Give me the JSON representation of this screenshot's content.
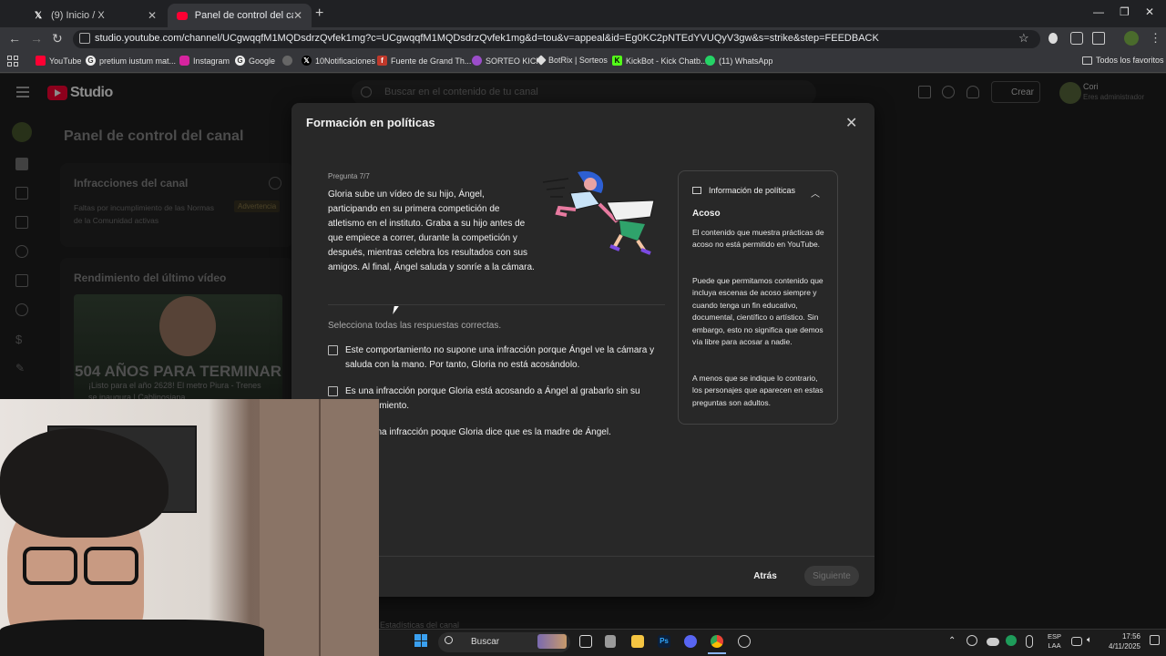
{
  "browser": {
    "tabs": [
      {
        "label": "(9) Inicio / X",
        "favicon": "X"
      },
      {
        "label": "Panel de control del canal - Yo",
        "favicon": "YT"
      }
    ],
    "url": "studio.youtube.com/channel/UCgwqqfM1MQDsdrzQvfek1mg?c=UCgwqqfM1MQDsdrzQvfek1mg&d=tou&v=appeal&id=Eg0KC2pNTEdYVUQyV3gw&s=strike&step=FEEDBACK",
    "bookmarks": [
      "YouTube",
      "pretium iustum mat...",
      "Instagram",
      "Google",
      "10Notificaciones",
      "Fuente de Grand Th...",
      "SORTEO KICK",
      "BotRix | Sorteos",
      "KickBot - Kick Chatb...",
      "(11) WhatsApp"
    ],
    "all_bookmarks": "Todos los favoritos"
  },
  "studio": {
    "logo": "Studio",
    "search_placeholder": "Buscar en el contenido de tu canal",
    "create": "Crear",
    "account_name": "Cori",
    "account_role": "Eres administrador",
    "dashboard_title": "Panel de control del canal",
    "infractions_title": "Infracciones del canal",
    "infractions_desc": "Faltas por incumplimiento de las Normas de la Comunidad activas",
    "infractions_badge": "Advertencia",
    "last_video_title": "Rendimiento del último vídeo",
    "thumb_text": "504 AÑOS PARA TERMINAR",
    "video_title": "¡Listo para el año 2628! El metro Piura - Trenes se inaugura | Cablinosiana",
    "analytics": "Estadísticas del canal"
  },
  "modal": {
    "title": "Formación en políticas",
    "counter": "Pregunta 7/7",
    "question": "Gloria sube un vídeo de su hijo, Ángel, participando en su primera competición de atletismo en el instituto. Graba a su hijo antes de que empiece a correr, durante la competición y después, mientras celebra los resultados con sus amigos. Al final, Ángel saluda y sonríe a la cámara.",
    "instruction": "Selecciona todas las respuestas correctas.",
    "options": [
      "Este comportamiento no supone una infracción porque Ángel ve la cámara y saluda con la mano. Por tanto, Gloria no está acosándolo.",
      "Es una infracción porque Gloria está acosando a Ángel al grabarlo sin su consentimiento.",
      "No es una infracción poque Gloria dice que es la madre de Ángel."
    ],
    "info_header": "Información de políticas",
    "info_topic": "Acoso",
    "info_paragraphs": [
      "El contenido que muestra prácticas de acoso no está permitido en YouTube.",
      "Puede que permitamos contenido que incluya escenas de acoso siempre y cuando tenga un fin educativo, documental, científico o artístico. Sin embargo, esto no significa que demos vía libre para acosar a nadie.",
      "A menos que se indique lo contrario, los personajes que aparecen en estas preguntas son adultos."
    ],
    "back": "Atrás",
    "next": "Siguiente"
  },
  "taskbar": {
    "search": "Buscar",
    "lang_top": "ESP",
    "lang_bottom": "LAA",
    "time": "17:56",
    "date": "4/11/2025"
  },
  "colors": {
    "accent_red": "#ff0033",
    "modal_bg": "#282828",
    "page_bg": "#1f1f1f"
  }
}
